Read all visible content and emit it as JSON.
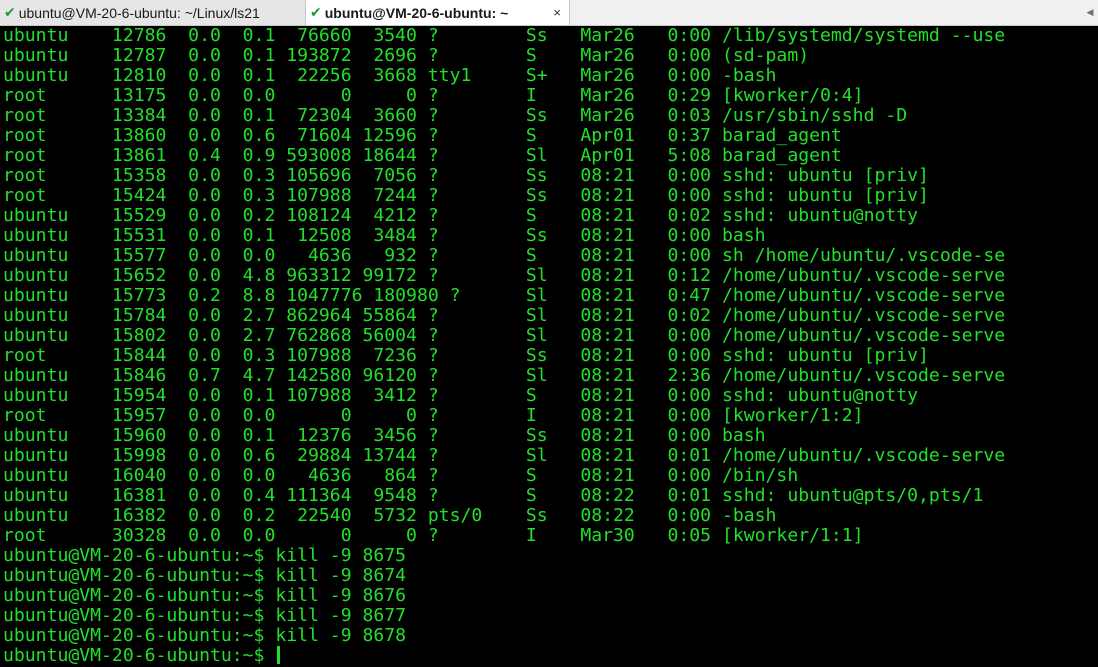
{
  "tabs": [
    {
      "label": "ubuntu@VM-20-6-ubuntu: ~/Linux/ls21",
      "active": false
    },
    {
      "label": "ubuntu@VM-20-6-ubuntu: ~",
      "active": true
    }
  ],
  "close_glyph": "×",
  "scroll_glyph": "◀",
  "colors": {
    "foreground": "#22e02a",
    "background": "#000000",
    "check": "#1e9e2e"
  },
  "terminal": {
    "process_lines": [
      "ubuntu    12786  0.0  0.1  76660  3540 ?        Ss   Mar26   0:00 /lib/systemd/systemd --use",
      "ubuntu    12787  0.0  0.1 193872  2696 ?        S    Mar26   0:00 (sd-pam)",
      "ubuntu    12810  0.0  0.1  22256  3668 tty1     S+   Mar26   0:00 -bash",
      "root      13175  0.0  0.0      0     0 ?        I    Mar26   0:29 [kworker/0:4]",
      "root      13384  0.0  0.1  72304  3660 ?        Ss   Mar26   0:03 /usr/sbin/sshd -D",
      "root      13860  0.0  0.6  71604 12596 ?        S    Apr01   0:37 barad_agent",
      "root      13861  0.4  0.9 593008 18644 ?        Sl   Apr01   5:08 barad_agent",
      "root      15358  0.0  0.3 105696  7056 ?        Ss   08:21   0:00 sshd: ubuntu [priv]",
      "root      15424  0.0  0.3 107988  7244 ?        Ss   08:21   0:00 sshd: ubuntu [priv]",
      "ubuntu    15529  0.0  0.2 108124  4212 ?        S    08:21   0:02 sshd: ubuntu@notty",
      "ubuntu    15531  0.0  0.1  12508  3484 ?        Ss   08:21   0:00 bash",
      "ubuntu    15577  0.0  0.0   4636   932 ?        S    08:21   0:00 sh /home/ubuntu/.vscode-se",
      "ubuntu    15652  0.0  4.8 963312 99172 ?        Sl   08:21   0:12 /home/ubuntu/.vscode-serve",
      "ubuntu    15773  0.2  8.8 1047776 180980 ?      Sl   08:21   0:47 /home/ubuntu/.vscode-serve",
      "ubuntu    15784  0.0  2.7 862964 55864 ?        Sl   08:21   0:02 /home/ubuntu/.vscode-serve",
      "ubuntu    15802  0.0  2.7 762868 56004 ?        Sl   08:21   0:00 /home/ubuntu/.vscode-serve",
      "root      15844  0.0  0.3 107988  7236 ?        Ss   08:21   0:00 sshd: ubuntu [priv]",
      "ubuntu    15846  0.7  4.7 142580 96120 ?        Sl   08:21   2:36 /home/ubuntu/.vscode-serve",
      "ubuntu    15954  0.0  0.1 107988  3412 ?        S    08:21   0:00 sshd: ubuntu@notty",
      "root      15957  0.0  0.0      0     0 ?        I    08:21   0:00 [kworker/1:2]",
      "ubuntu    15960  0.0  0.1  12376  3456 ?        Ss   08:21   0:00 bash",
      "ubuntu    15998  0.0  0.6  29884 13744 ?        Sl   08:21   0:01 /home/ubuntu/.vscode-serve",
      "ubuntu    16040  0.0  0.0   4636   864 ?        S    08:21   0:00 /bin/sh",
      "ubuntu    16381  0.0  0.4 111364  9548 ?        S    08:22   0:01 sshd: ubuntu@pts/0,pts/1",
      "ubuntu    16382  0.0  0.2  22540  5732 pts/0    Ss   08:22   0:00 -bash",
      "root      30328  0.0  0.0      0     0 ?        I    Mar30   0:05 [kworker/1:1]"
    ],
    "command_lines": [
      "ubuntu@VM-20-6-ubuntu:~$ kill -9 8675",
      "ubuntu@VM-20-6-ubuntu:~$ kill -9 8674",
      "ubuntu@VM-20-6-ubuntu:~$ kill -9 8676",
      "ubuntu@VM-20-6-ubuntu:~$ kill -9 8677",
      "ubuntu@VM-20-6-ubuntu:~$ kill -9 8678"
    ],
    "current_prompt": "ubuntu@VM-20-6-ubuntu:~$ "
  }
}
